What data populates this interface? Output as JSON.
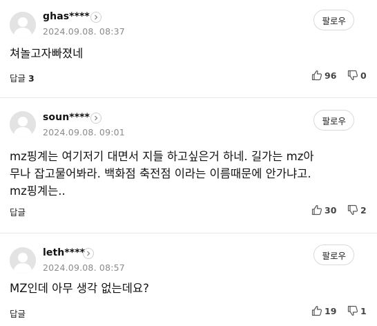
{
  "comments": [
    {
      "username": "ghas****",
      "timestamp": "2024.09.08. 08:37",
      "follow_label": "팔로우",
      "text": "쳐놀고자빠졌네",
      "reply_label": "답글",
      "reply_count": "3",
      "likes": "96",
      "dislikes": "0"
    },
    {
      "username": "soun****",
      "timestamp": "2024.09.08. 09:01",
      "follow_label": "팔로우",
      "text_lines": [
        "mz핑계는 여기저기 대면서 지들 하고싶은거 하네. 길가는 mz아",
        "무나 잡고물어봐라. 백화점 축전점 이라는 이름때문에 안가냐고.",
        "mz핑계는.."
      ],
      "reply_label": "답글",
      "likes": "30",
      "dislikes": "2"
    },
    {
      "username": "leth****",
      "timestamp": "2024.09.08. 08:57",
      "follow_label": "팔로우",
      "text": "MZ인데 아무 생각 없는데요?",
      "reply_label": "답글",
      "likes": "19",
      "dislikes": "1"
    }
  ],
  "icons": {
    "avatar": "default-avatar-icon",
    "profile_link": "chevron-right-icon",
    "like": "thumbs-up-icon",
    "dislike": "thumbs-down-icon"
  },
  "colors": {
    "avatar_bg": "#e3e3e3",
    "meta_text": "#8a8a8a",
    "divider": "#e6e6e6"
  }
}
